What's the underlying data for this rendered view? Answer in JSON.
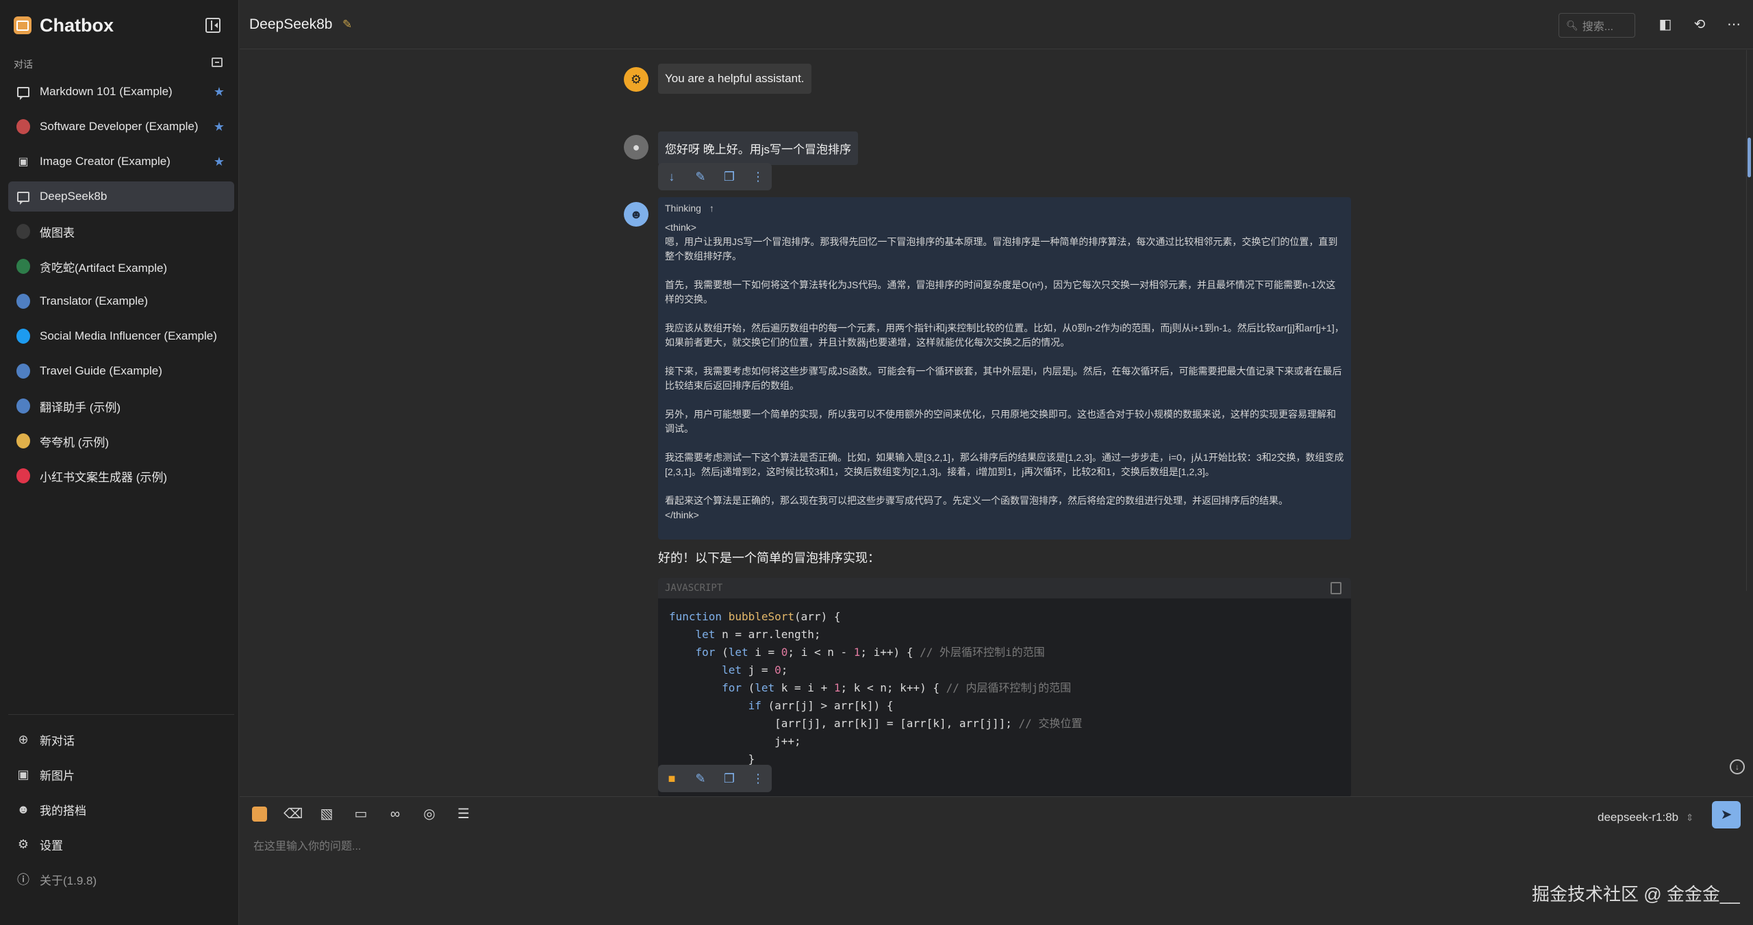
{
  "app": {
    "name": "Chatbox"
  },
  "sidebar": {
    "section_label": "对话",
    "conversations": [
      {
        "label": "Markdown 101 (Example)",
        "icon": "chat-bubble-icon",
        "starred": true
      },
      {
        "label": "Software Developer (Example)",
        "icon": "developer-avatar",
        "starred": true
      },
      {
        "label": "Image Creator (Example)",
        "icon": "image-icon",
        "starred": true
      },
      {
        "label": "DeepSeek8b",
        "icon": "chat-bubble-icon",
        "starred": false,
        "active": true
      },
      {
        "label": "做图表",
        "icon": "chart-avatar",
        "starred": false
      },
      {
        "label": "贪吃蛇(Artifact Example)",
        "icon": "snake-avatar",
        "starred": false
      },
      {
        "label": "Translator (Example)",
        "icon": "translator-avatar",
        "starred": false
      },
      {
        "label": "Social Media Influencer (Example)",
        "icon": "twitter-avatar",
        "starred": false
      },
      {
        "label": "Travel Guide (Example)",
        "icon": "travel-avatar",
        "starred": false
      },
      {
        "label": "翻译助手 (示例)",
        "icon": "translator-avatar",
        "starred": false
      },
      {
        "label": "夸夸机 (示例)",
        "icon": "praise-avatar",
        "starred": false
      },
      {
        "label": "小红书文案生成器 (示例)",
        "icon": "xiaohongshu-avatar",
        "starred": false
      }
    ],
    "bottom": {
      "new_chat": "新对话",
      "new_image": "新图片",
      "my_partners": "我的搭档",
      "settings": "设置",
      "about": "关于(1.9.8)"
    }
  },
  "header": {
    "title": "DeepSeek8b",
    "search_placeholder": "搜索..."
  },
  "messages": {
    "system": "You are a helpful assistant.",
    "user": "您好呀 晚上好。用js写一个冒泡排序",
    "thinking_label": "Thinking",
    "think_open": "<think>",
    "think_close": "</think>",
    "think_paragraphs": [
      "嗯，用户让我用JS写一个冒泡排序。那我得先回忆一下冒泡排序的基本原理。冒泡排序是一种简单的排序算法，每次通过比较相邻元素，交换它们的位置，直到整个数组排好序。",
      "首先，我需要想一下如何将这个算法转化为JS代码。通常，冒泡排序的时间复杂度是O(n²)，因为它每次只交换一对相邻元素，并且最坏情况下可能需要n-1次这样的交换。",
      "我应该从数组开始，然后遍历数组中的每一个元素，用两个指针i和j来控制比较的位置。比如，从0到n-2作为i的范围，而j则从i+1到n-1。然后比较arr[j]和arr[j+1]，如果前者更大，就交换它们的位置，并且计数器j也要递增，这样就能优化每次交换之后的情况。",
      "接下来，我需要考虑如何将这些步骤写成JS函数。可能会有一个循环嵌套，其中外层是i，内层是j。然后，在每次循环后，可能需要把最大值记录下来或者在最后比较结束后返回排序后的数组。",
      "另外，用户可能想要一个简单的实现，所以我可以不使用额外的空间来优化，只用原地交换即可。这也适合对于较小规模的数据来说，这样的实现更容易理解和调试。",
      "我还需要考虑测试一下这个算法是否正确。比如，如果输入是[3,2,1]，那么排序后的结果应该是[1,2,3]。通过一步步走，i=0，j从1开始比较：3和2交换，数组变成[2,3,1]。然后j递增到2，这时候比较3和1，交换后数组变为[2,1,3]。接着，i增加到1，j再次循环，比较2和1，交换后数组是[1,2,3]。",
      "看起来这个算法是正确的，那么现在我可以把这些步骤写成代码了。先定义一个函数冒泡排序，然后将给定的数组进行处理，并返回排序后的结果。"
    ],
    "answer_intro": "好的！以下是一个简单的冒泡排序实现：",
    "code_language": "JAVASCRIPT"
  },
  "code_lines": [
    [
      [
        "kw",
        "function "
      ],
      [
        "fn",
        "bubbleSort"
      ],
      [
        "",
        "(arr) {"
      ]
    ],
    [
      [
        "",
        "    "
      ],
      [
        "kw",
        "let"
      ],
      [
        "",
        " n = arr.length;"
      ]
    ],
    [
      [
        "",
        "    "
      ],
      [
        "kw",
        "for"
      ],
      [
        "",
        " ("
      ],
      [
        "kw",
        "let"
      ],
      [
        "",
        " i = "
      ],
      [
        "num",
        "0"
      ],
      [
        "",
        "; i < n - "
      ],
      [
        "num",
        "1"
      ],
      [
        "",
        "; i++) { "
      ],
      [
        "cm",
        "// 外层循环控制i的范围"
      ]
    ],
    [
      [
        "",
        "        "
      ],
      [
        "kw",
        "let"
      ],
      [
        "",
        " j = "
      ],
      [
        "num",
        "0"
      ],
      [
        ";",
        ";"
      ]
    ],
    [
      [
        "",
        "        "
      ],
      [
        "kw",
        "for"
      ],
      [
        "",
        " ("
      ],
      [
        "kw",
        "let"
      ],
      [
        "",
        " k = i + "
      ],
      [
        "num",
        "1"
      ],
      [
        "",
        "; k < n; k++) { "
      ],
      [
        "cm",
        "// 内层循环控制j的范围"
      ]
    ],
    [
      [
        "",
        "            "
      ],
      [
        "kw",
        "if"
      ],
      [
        "",
        " (arr[j] > arr[k]) {"
      ]
    ],
    [
      [
        "",
        "                [arr[j], arr[k]] = [arr[k], arr[j]]; "
      ],
      [
        "cm",
        "// 交换位置"
      ]
    ],
    [
      [
        "",
        "                j++;"
      ]
    ],
    [
      [
        "",
        "            }"
      ]
    ]
  ],
  "input": {
    "placeholder": "在这里输入你的问题...",
    "model": "deepseek-r1:8b"
  },
  "watermark": "掘金技术社区 @ 金金金__",
  "colors": {
    "accent": "#7fb0ea",
    "brand": "#e8a04a",
    "star": "#5b8fd6",
    "thinking_bg": "#263040"
  }
}
